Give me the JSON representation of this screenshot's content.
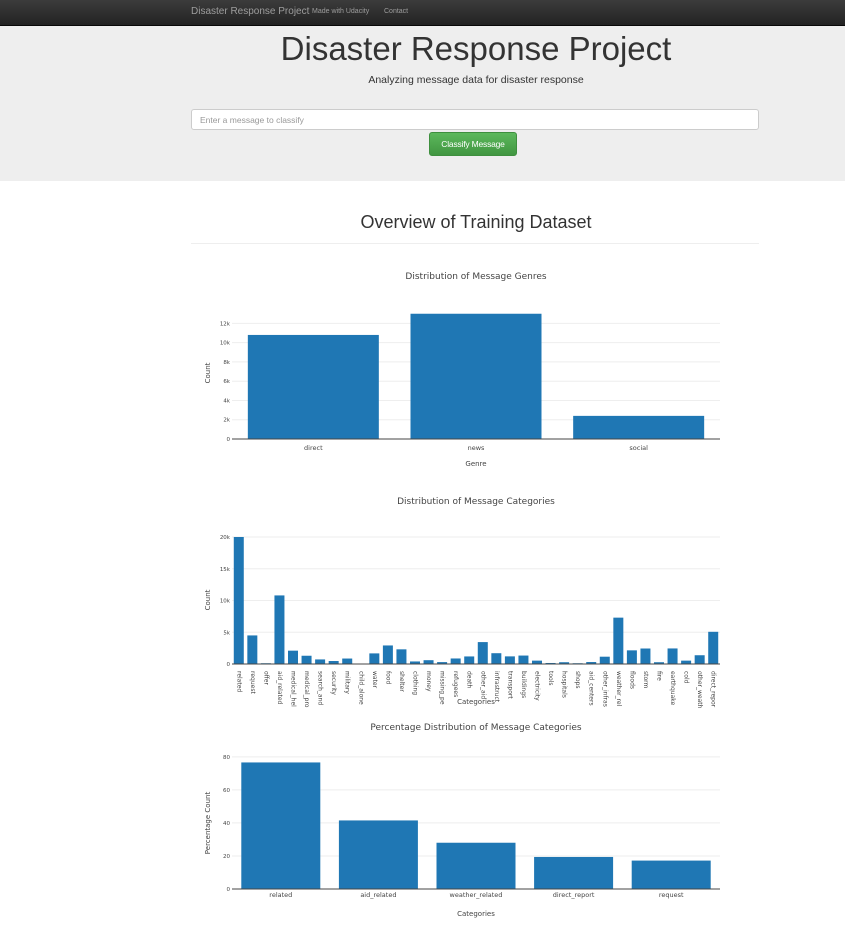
{
  "navbar": {
    "brand": "Disaster Response Project",
    "links": [
      "Made with Udacity",
      "Contact"
    ]
  },
  "header": {
    "title": "Disaster Response Project",
    "subtitle": "Analyzing message data for disaster response"
  },
  "classify": {
    "placeholder": "Enter a message to classify",
    "button_label": "Classify Message"
  },
  "overview": {
    "title": "Overview of Training Dataset"
  },
  "colors": {
    "bar": "#1f77b4",
    "navbar": "#222222",
    "jumbotron": "#eeeeee",
    "button": "#5cb85c"
  },
  "chart_data": [
    {
      "type": "bar",
      "title": "Distribution of Message Genres",
      "xlabel": "Genre",
      "ylabel": "Count",
      "categories": [
        "direct",
        "news",
        "social"
      ],
      "values": [
        10800,
        13000,
        2400
      ],
      "ylim": [
        0,
        13700
      ],
      "yticks": [
        0,
        2000,
        4000,
        6000,
        8000,
        10000,
        12000
      ],
      "yticklabels": [
        "0",
        "2k",
        "4k",
        "6k",
        "8k",
        "10k",
        "12k"
      ],
      "grid": true
    },
    {
      "type": "bar",
      "title": "Distribution of Message Categories",
      "xlabel": "Categories",
      "ylabel": "Count",
      "categories": [
        "related",
        "request",
        "offer",
        "aid_related",
        "medical_hel",
        "medical_pro",
        "search_and",
        "security",
        "military",
        "child_alone",
        "water",
        "food",
        "shelter",
        "clothing",
        "money",
        "missing_pe",
        "refugees",
        "death",
        "other_aid",
        "infrastruct",
        "transport",
        "buildings",
        "electricity",
        "tools",
        "hospitals",
        "shops",
        "aid_centers",
        "other_infras",
        "weather_rel",
        "floods",
        "storm",
        "fire",
        "earthquake",
        "cold",
        "other_weath",
        "direct_repor"
      ],
      "values": [
        20000,
        4500,
        120,
        10800,
        2100,
        1300,
        720,
        470,
        860,
        0,
        1670,
        2920,
        2310,
        400,
        600,
        300,
        870,
        1190,
        3450,
        1700,
        1200,
        1330,
        530,
        160,
        280,
        120,
        310,
        1150,
        7300,
        2150,
        2440,
        280,
        2450,
        530,
        1380,
        5070
      ],
      "ylim": [
        0,
        20000
      ],
      "yticks": [
        0,
        5000,
        10000,
        15000,
        20000
      ],
      "yticklabels": [
        "0",
        "5k",
        "10k",
        "15k",
        "20k"
      ],
      "grid": true
    },
    {
      "type": "bar",
      "title": "Percentage Distribution of Message Categories",
      "xlabel": "Categories",
      "ylabel": "Percentage Count",
      "categories": [
        "related",
        "aid_related",
        "weather_related",
        "direct_report",
        "request"
      ],
      "values": [
        76.6,
        41.5,
        28.0,
        19.4,
        17.2
      ],
      "ylim": [
        0,
        80.5
      ],
      "yticks": [
        0,
        20,
        40,
        60,
        80
      ],
      "yticklabels": [
        "0",
        "20",
        "40",
        "60",
        "80"
      ],
      "grid": true
    }
  ]
}
